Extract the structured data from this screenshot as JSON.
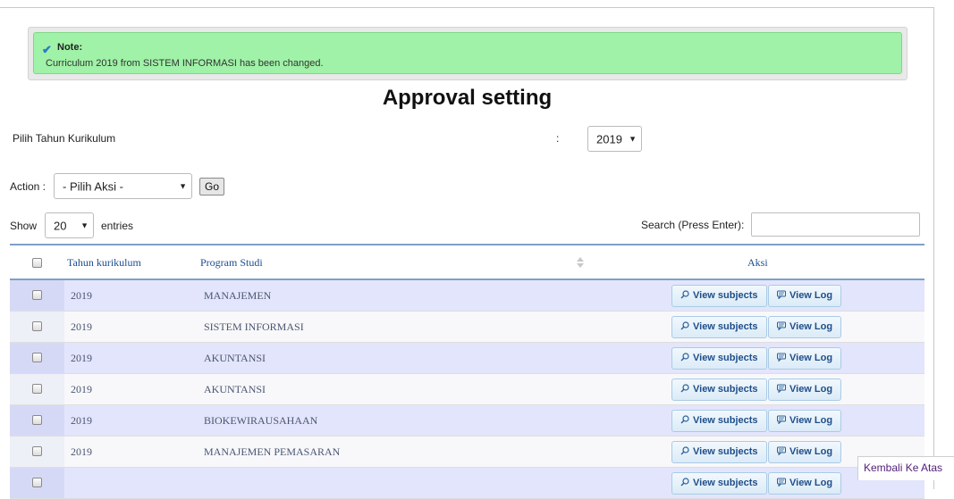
{
  "note": {
    "icon": "check-icon",
    "title": "Note:",
    "message": "Curriculum 2019 from SISTEM INFORMASI has been changed."
  },
  "page_title": "Approval setting",
  "year_filter": {
    "label": "Pilih Tahun Kurikulum",
    "colon": ":",
    "selected": "2019"
  },
  "action": {
    "label": "Action :",
    "selected": "- Pilih Aksi -",
    "go_label": "Go"
  },
  "length": {
    "show_label": "Show",
    "selected": "20",
    "entries_label": "entries"
  },
  "search": {
    "label": "Search (Press Enter):",
    "value": ""
  },
  "table": {
    "columns": [
      "Tahun kurikulum",
      "Program Studi",
      "Aksi"
    ],
    "view_subjects_label": "View subjects",
    "view_log_label": "View Log",
    "rows": [
      {
        "year": "2019",
        "prodi": "MANAJEMEN"
      },
      {
        "year": "2019",
        "prodi": "SISTEM INFORMASI"
      },
      {
        "year": "2019",
        "prodi": "AKUNTANSI"
      },
      {
        "year": "2019",
        "prodi": "AKUNTANSI"
      },
      {
        "year": "2019",
        "prodi": "BIOKEWIRAUSAHAAN"
      },
      {
        "year": "2019",
        "prodi": "MANAJEMEN PEMASARAN"
      },
      {
        "year": "",
        "prodi": ""
      }
    ]
  },
  "back_to_top": "Kembali Ke Atas"
}
